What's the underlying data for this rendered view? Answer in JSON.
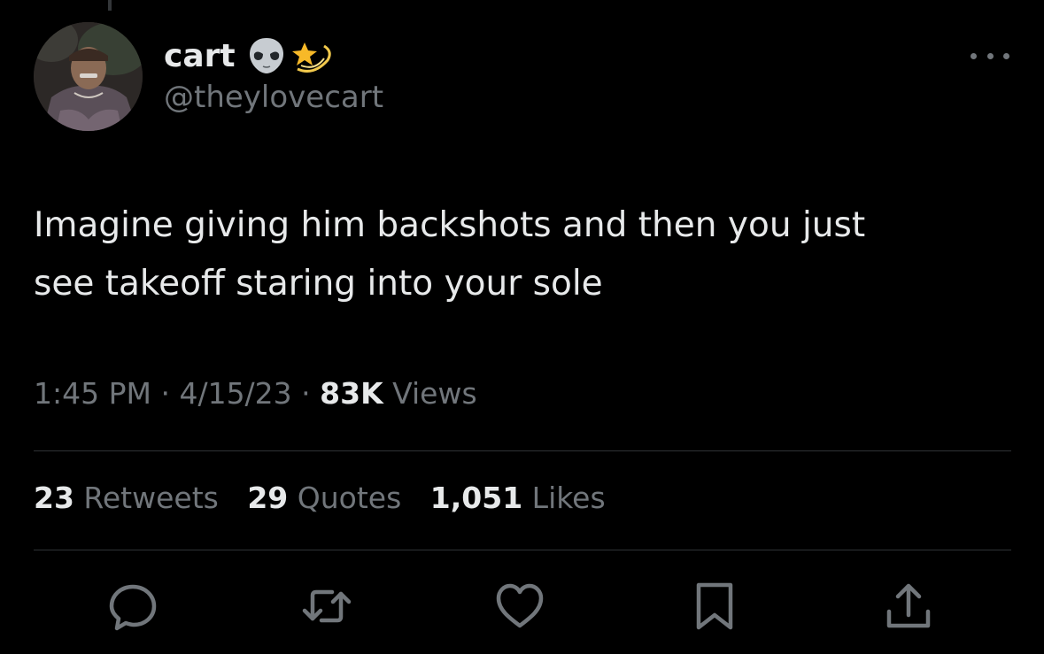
{
  "user": {
    "display_name": "cart",
    "handle": "@theylovecart",
    "emojis": [
      "alien-emoji",
      "dizzy-star-emoji"
    ]
  },
  "tweet": {
    "text_line1": "Imagine giving him backshots and then you just",
    "text_line2": "see takeoff staring into your sole"
  },
  "meta": {
    "time": "1:45 PM",
    "sep1": " · ",
    "date": "4/15/23",
    "sep2": " · ",
    "views_count": "83K",
    "views_label": " Views"
  },
  "stats": {
    "retweets_count": "23",
    "retweets_label": " Retweets",
    "quotes_count": "29",
    "quotes_label": " Quotes",
    "likes_count": "1,051",
    "likes_label": " Likes"
  },
  "icons": {
    "reply": "reply-icon",
    "retweet": "retweet-icon",
    "like": "heart-icon",
    "bookmark": "bookmark-icon",
    "share": "share-icon",
    "more": "more-icon"
  },
  "colors": {
    "background": "#000000",
    "primary_text": "#e7e9ea",
    "secondary_text": "#71767b",
    "divider": "#2f3336"
  }
}
